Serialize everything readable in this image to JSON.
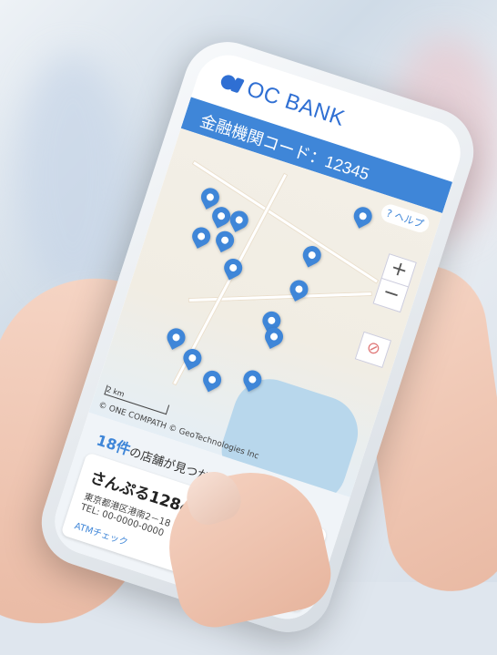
{
  "brand": {
    "name": "OC BANK"
  },
  "code_bar": {
    "label": "金融機関コード：12345"
  },
  "map": {
    "help_label": "ヘルプ",
    "zoom_in": "+",
    "zoom_out": "−",
    "scale_label": "2 km",
    "copyright": "© ONE COMPATH © GeoTechnologies Inc"
  },
  "results": {
    "count_number": "18件",
    "count_suffix": "の店舗が見つかりました",
    "first_card": {
      "name": "さんぷる1284",
      "address": "東京都港区港南2－18",
      "tel": "TEL: 00-0000-0000",
      "link": "ATMチェック"
    }
  },
  "colors": {
    "accent": "#3f86d8",
    "background": "#dfe6ee"
  }
}
